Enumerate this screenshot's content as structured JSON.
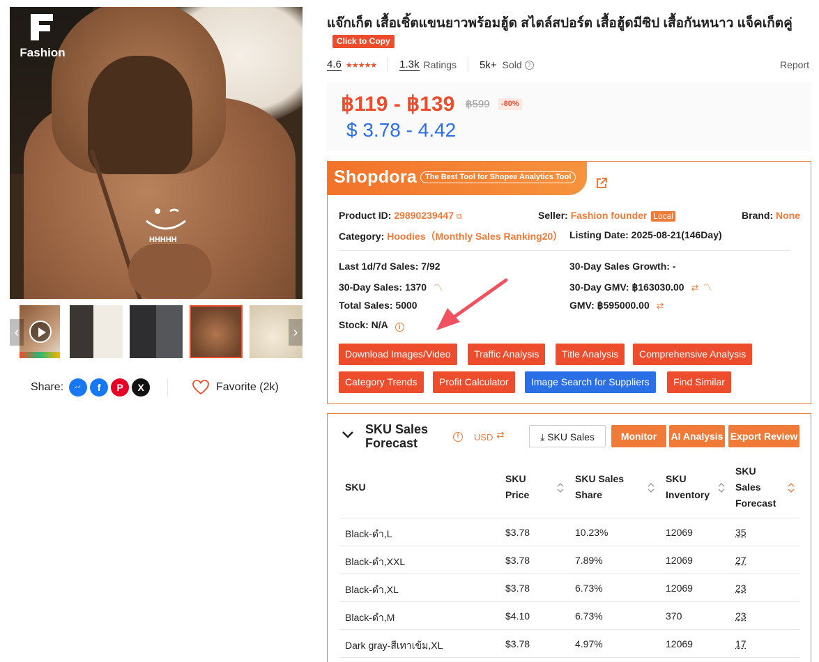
{
  "product": {
    "title": "แจ๊กเก็ต เสื้อเชิ้ตแขนยาวพร้อมฮู้ด สไตล์สปอร์ต เสื้อฮู้ดมีซิป เสื้อกันหนาว แจ็คเก็ตคู่",
    "copy_label": "Click to Copy",
    "rating": "4.6",
    "ratings_count": "1.3k",
    "ratings_label": "Ratings",
    "sold_count": "5k+",
    "sold_label": "Sold",
    "report_label": "Report",
    "price_range": "฿119 - ฿139",
    "price_original": "฿599",
    "discount": "-80%",
    "price_usd": "$ 3.78 - 4.42"
  },
  "gallery": {
    "brand_logo_text": "Fashion",
    "thumbnails": [
      "video",
      "white-black pair",
      "dark gray pair",
      "brown",
      "cream"
    ],
    "selected_index": 3
  },
  "share": {
    "label": "Share:",
    "networks": [
      "messenger-icon",
      "facebook-icon",
      "pinterest-icon",
      "x-icon"
    ],
    "favorite_label": "Favorite (2k)"
  },
  "shopdora": {
    "brand": "Shopdora",
    "tagline": "The Best Tool for Shopee Analytics Tool",
    "product_id_label": "Product ID:",
    "product_id": "29890239447",
    "seller_label": "Seller:",
    "seller": "Fashion founder",
    "seller_badge": "Local",
    "brand_label": "Brand:",
    "brand_value": "None",
    "category_label": "Category:",
    "category_value": "Hoodies（Monthly Sales Ranking20）",
    "listing_label": "Listing Date:",
    "listing_value": "2025-08-21(146Day)",
    "stats": {
      "last_sales": "Last 1d/7d Sales: 7/92",
      "sales_30": "30-Day Sales: 1370",
      "total_sales": "Total Sales: 5000",
      "stock": "Stock: N/A",
      "growth_30": "30-Day Sales Growth: -",
      "gmv_30": "30-Day GMV: ฿163030.00",
      "gmv": "GMV: ฿595000.00"
    },
    "buttons": {
      "download": "Download Images/Video",
      "traffic": "Traffic Analysis",
      "title": "Title Analysis",
      "comprehensive": "Comprehensive Analysis",
      "category_trends": "Category Trends",
      "profit": "Profit Calculator",
      "image_search": "Image Search for Suppliers",
      "find_similar": "Find Similar"
    }
  },
  "sku_panel": {
    "title": "SKU Sales Forecast",
    "currency": "USD",
    "sku_sales_btn": "SKU Sales",
    "monitor_btn": "Monitor",
    "ai_btn": "AI Analysis",
    "export_btn": "Export Review",
    "headers": {
      "sku": "SKU",
      "price": "SKU Price",
      "share": "SKU Sales Share",
      "inventory": "SKU Inventory",
      "forecast": "SKU Sales Forecast"
    },
    "rows": [
      {
        "sku": "Black-ดำ,L",
        "price": "$3.78",
        "share": "10.23%",
        "inventory": "12069",
        "forecast": "35"
      },
      {
        "sku": "Black-ดำ,XXL",
        "price": "$3.78",
        "share": "7.89%",
        "inventory": "12069",
        "forecast": "27"
      },
      {
        "sku": "Black-ดำ,XL",
        "price": "$3.78",
        "share": "6.73%",
        "inventory": "12069",
        "forecast": "23"
      },
      {
        "sku": "Black-ดำ,M",
        "price": "$4.10",
        "share": "6.73%",
        "inventory": "370",
        "forecast": "23"
      },
      {
        "sku": "Dark gray-สีเทาเข้ม,XL",
        "price": "$3.78",
        "share": "4.97%",
        "inventory": "12069",
        "forecast": "17"
      }
    ]
  }
}
